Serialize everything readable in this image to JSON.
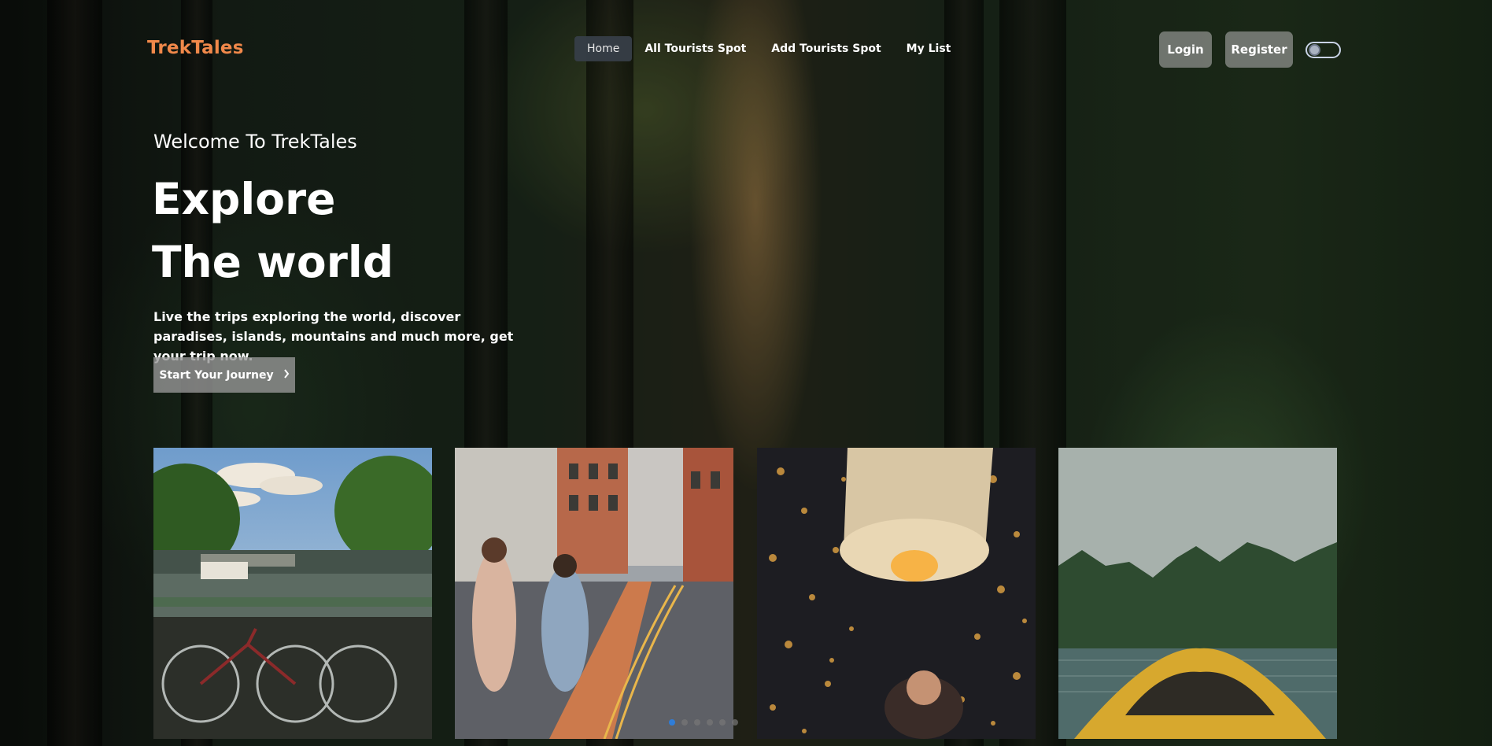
{
  "brand": {
    "name": "TrekTales",
    "color": "#f0884a"
  },
  "nav": {
    "items": [
      {
        "label": "Home",
        "active": true
      },
      {
        "label": "All Tourists Spot",
        "active": false
      },
      {
        "label": "Add Tourists Spot",
        "active": false
      },
      {
        "label": "My List",
        "active": false
      }
    ],
    "login_label": "Login",
    "register_label": "Register",
    "theme_toggle_icon": "theme-toggle-icon"
  },
  "hero": {
    "welcome": "Welcome To TrekTales",
    "headline_line1": "Explore",
    "headline_line2": "The world",
    "lede": "Live the trips exploring the world, discover paradises, islands, mountains and much more, get your trip now.",
    "cta_label": "Start Your Journey",
    "cta_icon": "chevron-right-icon"
  },
  "carousel": {
    "slides": [
      {
        "subject": "canal-with-bicycles"
      },
      {
        "subject": "city-street-with-pedestrians"
      },
      {
        "subject": "sky-lantern-festival"
      },
      {
        "subject": "kayak-on-lake-with-mountains"
      }
    ],
    "active_dot": 0,
    "dot_count": 6,
    "accent": "#2f7dd8"
  }
}
